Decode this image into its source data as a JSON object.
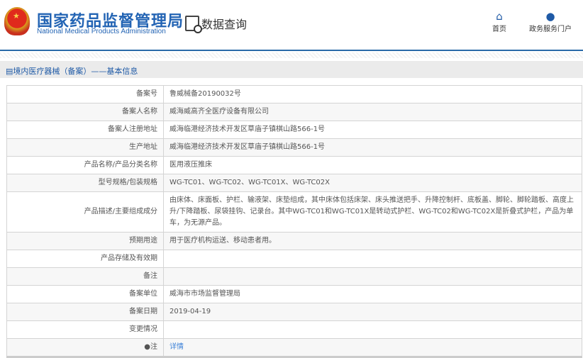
{
  "header": {
    "title_cn": "国家药品监督管理局",
    "title_en": "National Medical Products Administration",
    "data_query": "数据查询",
    "nav": [
      {
        "label": "首页",
        "icon": "home-icon"
      },
      {
        "label": "政务服务门户",
        "icon": "user-icon"
      }
    ]
  },
  "breadcrumb": "境内医疗器械（备案）——基本信息",
  "rows": [
    {
      "label": "备案号",
      "value": "鲁威械备20190032号"
    },
    {
      "label": "备案人名称",
      "value": "威海威高齐全医疗设备有限公司"
    },
    {
      "label": "备案人注册地址",
      "value": "威海临港经济技术开发区草庙子镇棋山路566-1号"
    },
    {
      "label": "生产地址",
      "value": "威海临港经济技术开发区草庙子镇棋山路566-1号"
    },
    {
      "label": "产品名称/产品分类名称",
      "value": "医用液压推床"
    },
    {
      "label": "型号规格/包装规格",
      "value": "WG-TC01、WG-TC02、WG-TC01X、WG-TC02X"
    },
    {
      "label": "产品描述/主要组成成分",
      "value": "由床体、床面板、护栏、输液架、床垫组成，其中床体包括床架、床头推送把手、升降控制杆、底板盖、脚轮、脚轮踏板、高度上升/下降踏板、尿袋挂钩、记录台。其中WG-TC01和WG-TC01X是转动式护栏、WG-TC02和WG-TC02X是折叠式护栏，产品为单车，为无源产品。"
    },
    {
      "label": "预期用途",
      "value": "用于医疗机构运送、移动患者用。"
    },
    {
      "label": "产品存储及有效期",
      "value": ""
    },
    {
      "label": "备注",
      "value": ""
    },
    {
      "label": "备案单位",
      "value": "威海市市场监督管理局"
    },
    {
      "label": "备案日期",
      "value": "2019-04-19"
    },
    {
      "label": "变更情况",
      "value": ""
    }
  ],
  "note": {
    "label": "注",
    "link": "详情"
  }
}
